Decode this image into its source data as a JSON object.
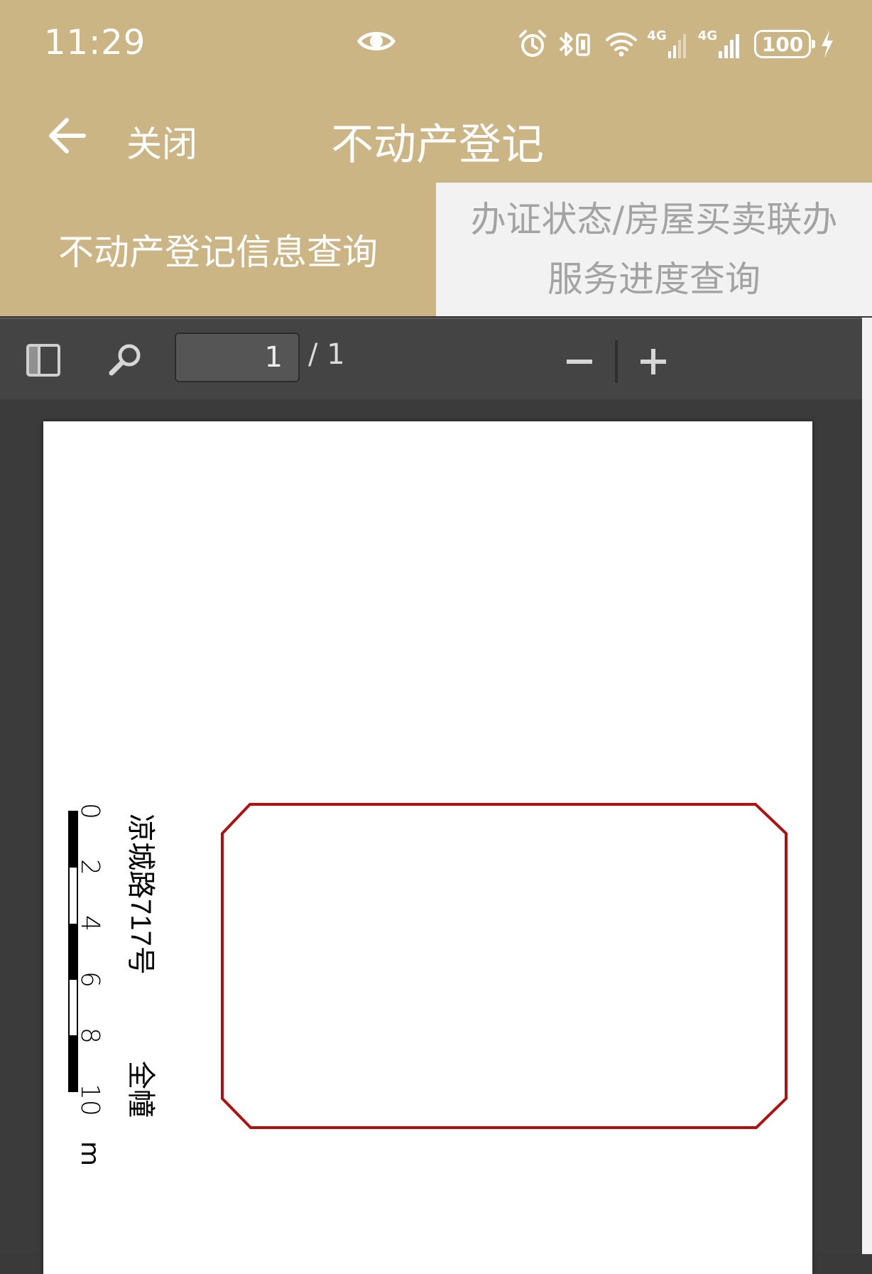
{
  "status_bar": {
    "time": "11:29",
    "net1": "4G",
    "net2": "4G",
    "battery": "100"
  },
  "title_bar": {
    "close_label": "关闭",
    "title": "不动产登记"
  },
  "tabs": [
    {
      "label": "不动产登记信息查询",
      "active": true
    },
    {
      "label_line1": "办证状态/房屋买卖联办",
      "label_line2": "服务进度查询",
      "active": false
    }
  ],
  "pdf_toolbar": {
    "page_value": "1",
    "page_count": "/ 1"
  },
  "drawing": {
    "address": "凉城路717号",
    "scope": "全幢",
    "scale_ticks": [
      "0",
      "2",
      "4",
      "6",
      "8",
      "10"
    ],
    "scale_unit": "m",
    "outline_color": "#b01010"
  },
  "colors": {
    "accent": "#cbb585",
    "tab_inactive_bg": "#f2f2f2",
    "tab_inactive_text": "#a3a3a3"
  }
}
